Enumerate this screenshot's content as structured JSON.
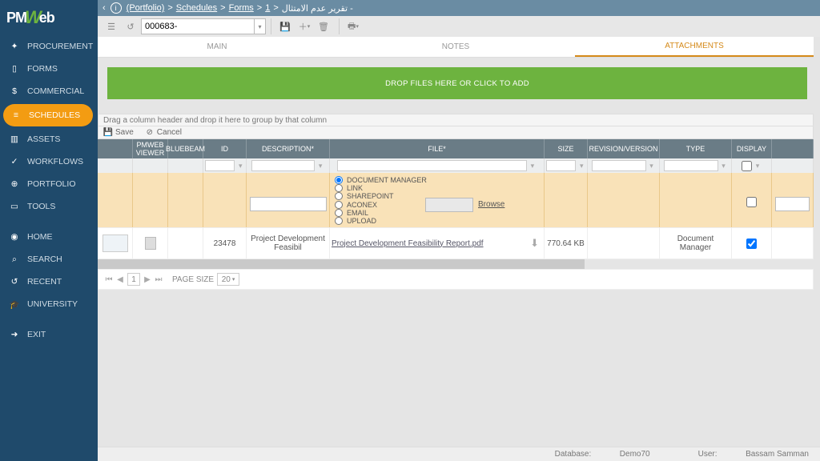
{
  "logo": {
    "p1": "PM",
    "w": "W",
    "p2": "eb"
  },
  "breadcrumb": {
    "root": "(Portfolio)",
    "l1": "Schedules",
    "l2": "Forms",
    "l3": "1",
    "tail": "تقرير عدم الامتثال -"
  },
  "toolbar": {
    "record": "000683-"
  },
  "sidebar": {
    "items": [
      {
        "label": "PROCUREMENT"
      },
      {
        "label": "FORMS"
      },
      {
        "label": "COMMERCIAL"
      },
      {
        "label": "SCHEDULES"
      },
      {
        "label": "ASSETS"
      },
      {
        "label": "WORKFLOWS"
      },
      {
        "label": "PORTFOLIO"
      },
      {
        "label": "TOOLS"
      },
      {
        "label": "HOME"
      },
      {
        "label": "SEARCH"
      },
      {
        "label": "RECENT"
      },
      {
        "label": "UNIVERSITY"
      },
      {
        "label": "EXIT"
      }
    ]
  },
  "tabs": {
    "main": "MAIN",
    "notes": "NOTES",
    "attachments": "ATTACHMENTS"
  },
  "dropzone": "DROP FILES HERE OR CLICK TO ADD",
  "group_hint": "Drag a column header and drop it here to group by that column",
  "actions": {
    "save": "Save",
    "cancel": "Cancel"
  },
  "columns": {
    "pmviewer": "PMWEB VIEWER",
    "bluebeam": "BLUEBEAM",
    "id": "ID",
    "desc": "DESCRIPTION*",
    "file": "FILE*",
    "size": "SIZE",
    "rev": "REVISION/VERSION",
    "type": "TYPE",
    "display": "DISPLAY"
  },
  "edit": {
    "radios": [
      "DOCUMENT MANAGER",
      "LINK",
      "SHAREPOINT",
      "ACONEX",
      "EMAIL",
      "UPLOAD"
    ],
    "browse": "Browse"
  },
  "row": {
    "id": "23478",
    "desc": "Project Development Feasibil",
    "file": "Project Development Feasibility Report.pdf",
    "size": "770.64 KB",
    "type": "Document Manager"
  },
  "pager": {
    "page": "1",
    "label": "PAGE SIZE",
    "size": "20"
  },
  "status": {
    "db_label": "Database:",
    "db": "Demo70",
    "user_label": "User:",
    "user": "Bassam Samman"
  }
}
